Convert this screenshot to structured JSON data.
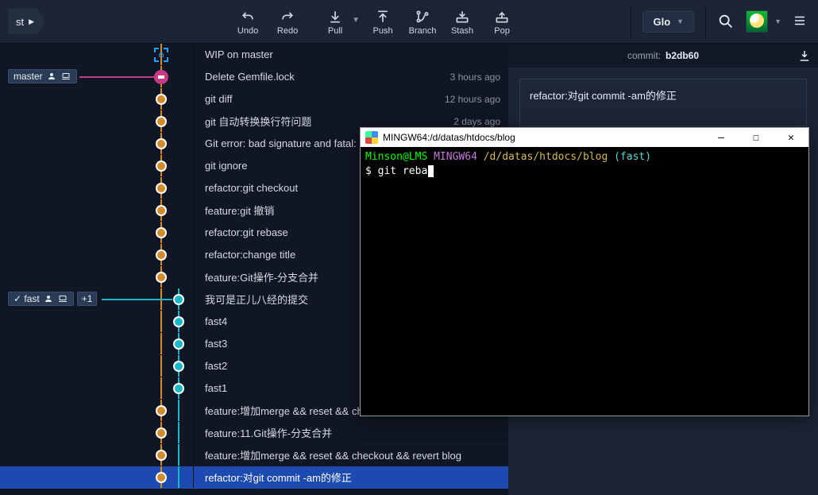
{
  "topbar": {
    "current_branch": "st",
    "buttons": {
      "undo": "Undo",
      "redo": "Redo",
      "pull": "Pull",
      "push": "Push",
      "branch": "Branch",
      "stash": "Stash",
      "pop": "Pop"
    },
    "glo_label": "Glo"
  },
  "commit_panel": {
    "label": "commit:",
    "hash": "b2db60",
    "message": "refactor:对git commit -am的修正"
  },
  "branches": {
    "master": "master",
    "fast": "fast",
    "fast_count": "+1"
  },
  "commits": [
    {
      "msg": "WIP on master",
      "time": "",
      "kind": "stash",
      "col": 1
    },
    {
      "msg": "Delete Gemfile.lock",
      "time": "3 hours ago",
      "kind": "special",
      "col": 1,
      "badge": "master"
    },
    {
      "msg": "git diff",
      "time": "12 hours ago",
      "kind": "orange",
      "col": 1
    },
    {
      "msg": "git 自动转换换行符问题",
      "time": "2 days ago",
      "kind": "orange",
      "col": 1
    },
    {
      "msg": "Git error: bad signature and fatal:",
      "time": "",
      "kind": "orange",
      "col": 1
    },
    {
      "msg": "git ignore",
      "time": "",
      "kind": "orange",
      "col": 1
    },
    {
      "msg": "refactor:git checkout",
      "time": "",
      "kind": "orange",
      "col": 1
    },
    {
      "msg": "feature:git 撤销",
      "time": "",
      "kind": "orange",
      "col": 1
    },
    {
      "msg": "refactor:git rebase",
      "time": "",
      "kind": "orange",
      "col": 1
    },
    {
      "msg": "refactor:change title",
      "time": "",
      "kind": "orange",
      "col": 1
    },
    {
      "msg": "feature:Git操作-分支合并",
      "time": "",
      "kind": "orange",
      "col": 1
    },
    {
      "msg": "我可是正儿八经的提交",
      "time": "",
      "kind": "cyan",
      "col": 2,
      "badge": "fast"
    },
    {
      "msg": "fast4",
      "time": "",
      "kind": "cyan",
      "col": 2
    },
    {
      "msg": "fast3",
      "time": "",
      "kind": "cyan",
      "col": 2
    },
    {
      "msg": "fast2",
      "time": "",
      "kind": "cyan",
      "col": 2
    },
    {
      "msg": "fast1",
      "time": "",
      "kind": "cyan",
      "col": 2
    },
    {
      "msg": "feature:增加merge && reset && ch",
      "time": "",
      "kind": "orange",
      "col": 1
    },
    {
      "msg": "feature:11.Git操作-分支合并",
      "time": "",
      "kind": "orange",
      "col": 1
    },
    {
      "msg": "feature:增加merge && reset && checkout && revert blog",
      "time": "",
      "kind": "orange",
      "col": 1
    },
    {
      "msg": "refactor:对git commit -am的修正",
      "time": "",
      "kind": "orange",
      "col": 1,
      "selected": true
    }
  ],
  "terminal": {
    "title": "MINGW64:/d/datas/htdocs/blog",
    "prompt_user": "Minson@LMS",
    "prompt_env": "MINGW64",
    "prompt_path": "/d/datas/htdocs/blog",
    "prompt_branch": "(fast)",
    "command_line": "$ git reba"
  }
}
